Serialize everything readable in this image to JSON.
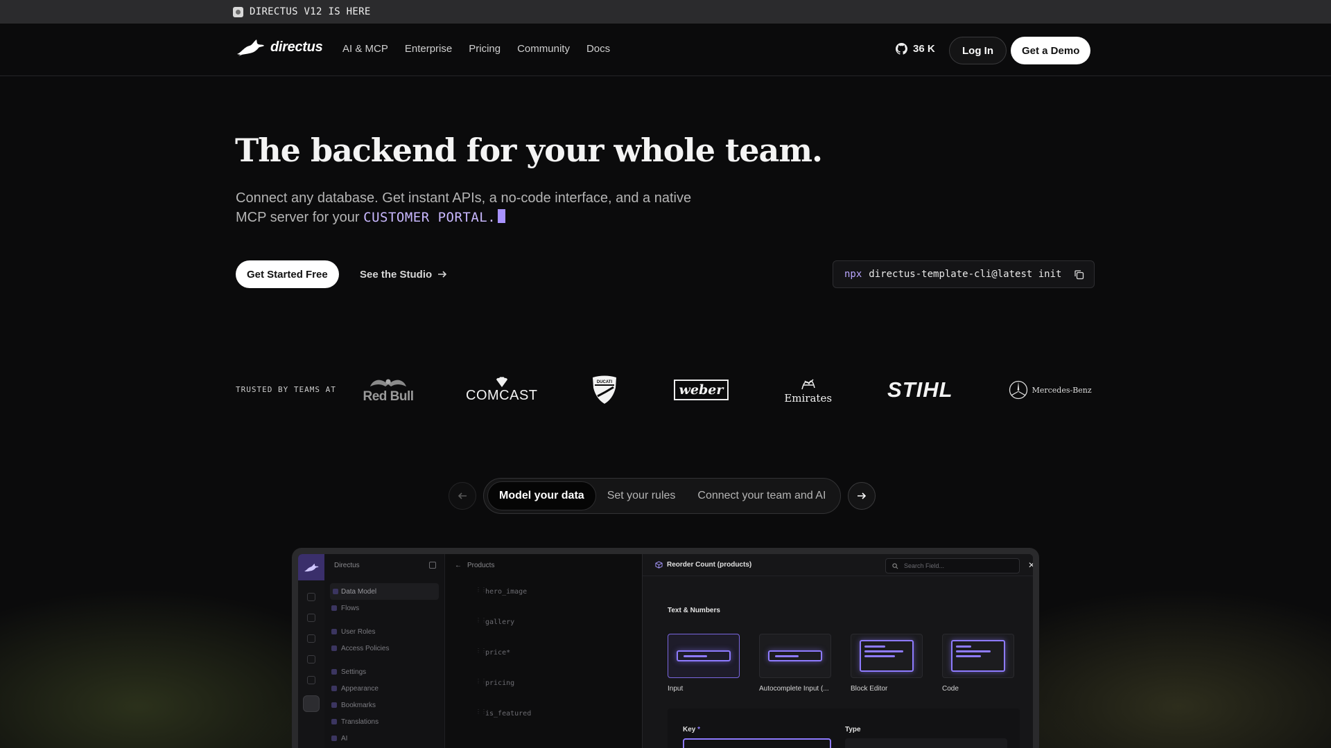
{
  "announcement": {
    "text": "DIRECTUS V12 IS HERE"
  },
  "nav": {
    "brand": "directus",
    "links": [
      "AI & MCP",
      "Enterprise",
      "Pricing",
      "Community",
      "Docs"
    ],
    "github_stars": "36 K",
    "login_label": "Log In",
    "demo_label": "Get a Demo"
  },
  "hero": {
    "title": "The backend for your whole team.",
    "subtitle_line1": "Connect any database. Get instant APIs, a no-code interface, and a native",
    "subtitle_line2": "MCP server for your",
    "highlight": "CUSTOMER PORTAL.",
    "cta_primary": "Get Started Free",
    "cta_secondary": "See the Studio",
    "cli_prefix": "npx",
    "cli_command": "directus-template-cli@latest init"
  },
  "trusted": {
    "label": "TRUSTED BY TEAMS AT",
    "logos": [
      "Red Bull",
      "COMCAST",
      "DUCATI",
      "weber",
      "Emirates",
      "STIHL",
      "Mercedes-Benz"
    ]
  },
  "carousel": {
    "tabs": [
      "Model your data",
      "Set your rules",
      "Connect your team and AI"
    ],
    "active_index": 0
  },
  "app": {
    "sidebar_title": "Directus",
    "sidebar_items": [
      "Data Model",
      "Flows",
      "User Roles",
      "Access Policies",
      "Settings",
      "Appearance",
      "Bookmarks",
      "Translations",
      "AI"
    ],
    "breadcrumb": "Products",
    "fields": [
      "hero_image",
      "gallery",
      "price*",
      "pricing",
      "is_featured"
    ],
    "drawer_title": "Reorder Count (products)",
    "search_placeholder": "Search Field...",
    "section_title": "Text & Numbers",
    "interfaces": [
      "Input",
      "Autocomplete Input (...",
      "Block Editor",
      "Code"
    ],
    "key_label": "Key",
    "type_label": "Type"
  },
  "colors": {
    "accent": "#8e7bff",
    "background": "#0b0b0c",
    "highlight_text": "#c9b8ff"
  }
}
